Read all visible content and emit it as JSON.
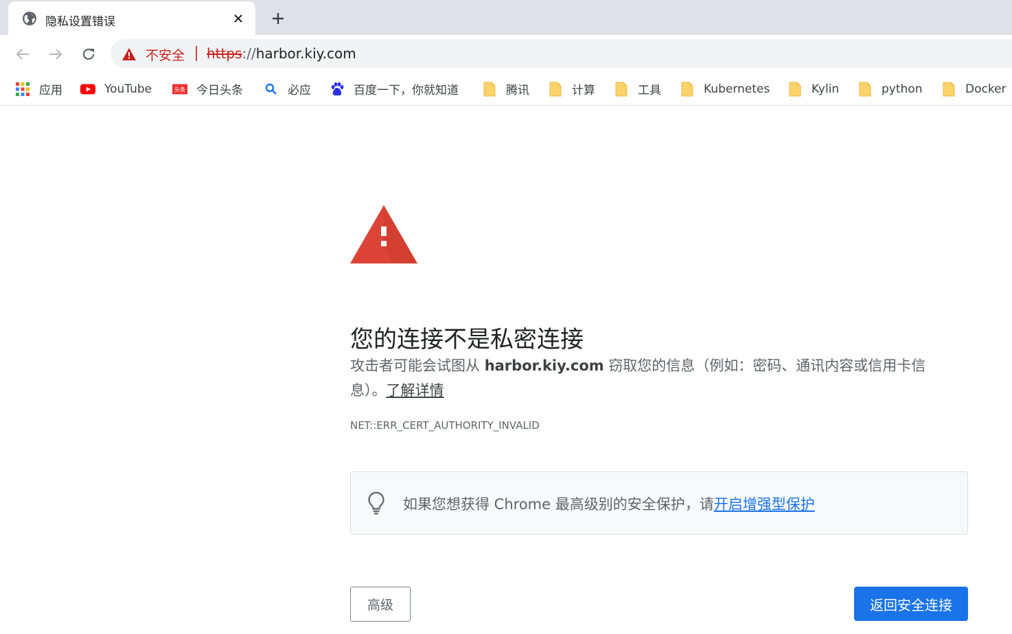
{
  "tab": {
    "title": "隐私设置错误",
    "favicon": "globe-icon",
    "close": "close-icon"
  },
  "new_tab": "plus-icon",
  "toolbar": {
    "back": "arrow-left-icon",
    "forward": "arrow-right-icon",
    "reload": "reload-icon",
    "security_label": "不安全",
    "url_scheme": "https",
    "url_sep": "://",
    "url_host": "harbor.kiy.com"
  },
  "bookmarks": [
    {
      "label": "应用",
      "icon": "apps-grid-icon"
    },
    {
      "label": "YouTube",
      "icon": "youtube-icon"
    },
    {
      "label": "今日头条",
      "icon": "toutiao-icon"
    },
    {
      "label": "必应",
      "icon": "bing-search-icon"
    },
    {
      "label": "百度一下，你就知道",
      "icon": "baidu-paw-icon"
    },
    {
      "label": "腾讯",
      "icon": "folder-icon"
    },
    {
      "label": "计算",
      "icon": "folder-icon"
    },
    {
      "label": "工具",
      "icon": "folder-icon"
    },
    {
      "label": "Kubernetes",
      "icon": "folder-icon"
    },
    {
      "label": "Kylin",
      "icon": "folder-icon"
    },
    {
      "label": "python",
      "icon": "folder-icon"
    },
    {
      "label": "Docker",
      "icon": "folder-icon"
    }
  ],
  "content": {
    "heading": "您的连接不是私密连接",
    "desc_before": "攻击者可能会试图从 ",
    "desc_host": "harbor.kiy.com",
    "desc_after": " 窃取您的信息（例如：密码、通讯内容或信用卡信息）。",
    "learn_more": "了解详情",
    "error_code": "NET::ERR_CERT_AUTHORITY_INVALID",
    "enhanced_text": "如果您想获得 Chrome 最高级别的安全保护，请",
    "enhanced_link": "开启增强型保护",
    "advanced_button": "高级",
    "back_button": "返回安全连接"
  },
  "colors": {
    "danger": "#db4437",
    "link_blue": "#1a73e8",
    "not_secure_red": "#c5221f",
    "folder_yellow": "#fbd36b"
  }
}
